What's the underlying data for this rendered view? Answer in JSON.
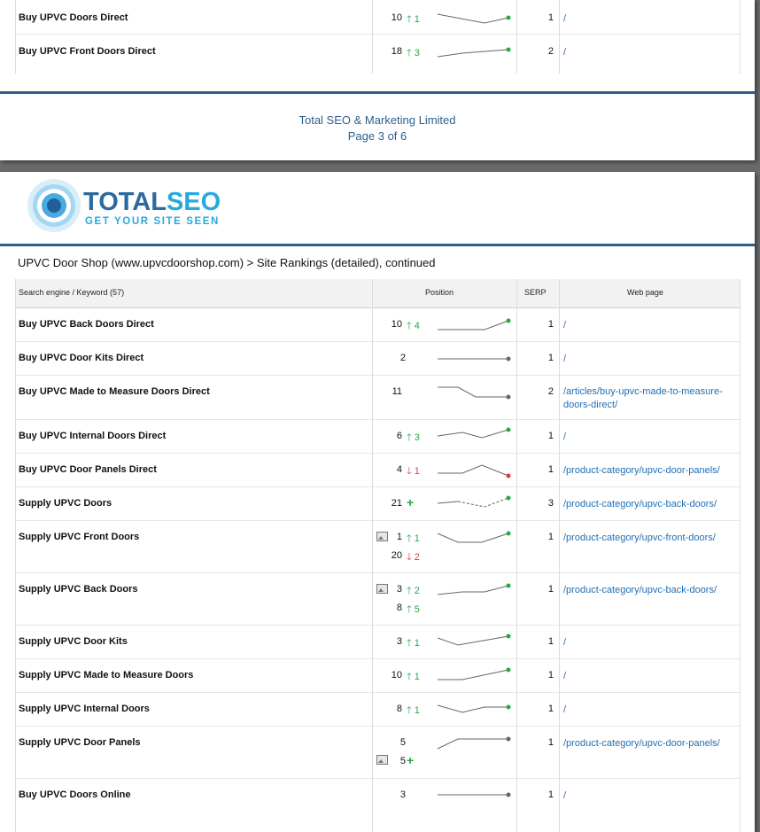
{
  "page1": {
    "rows": [
      {
        "keyword": "Buy UPVC Doors Direct",
        "position": "10",
        "change": "1",
        "trend": "up",
        "serp": "1",
        "url": "/"
      },
      {
        "keyword": "Buy UPVC Front Doors Direct",
        "position": "18",
        "change": "3",
        "trend": "up",
        "serp": "2",
        "url": "/"
      }
    ],
    "footer": {
      "company": "Total SEO & Marketing Limited",
      "page": "Page 3 of 6"
    }
  },
  "logo": {
    "name_part1": "TOTAL",
    "name_part2": "SEO",
    "tagline": "GET YOUR SITE SEEN",
    "color_dark": "#2a6aa0",
    "color_light": "#29a8e0"
  },
  "report": {
    "heading": "UPVC Door Shop (www.upvcdoorshop.com) > Site Rankings (detailed), continued"
  },
  "table": {
    "headers": {
      "keyword": "Search engine / Keyword (57)",
      "position": "Position",
      "serp": "SERP",
      "webpage": "Web page"
    },
    "rows": [
      {
        "keyword": "Buy UPVC Back Doors Direct",
        "positions": [
          {
            "value": "10",
            "change": "4",
            "trend": "up"
          }
        ],
        "serp": "1",
        "url": "/"
      },
      {
        "keyword": "Buy UPVC Door Kits Direct",
        "positions": [
          {
            "value": "2",
            "change": "",
            "trend": "none"
          }
        ],
        "serp": "1",
        "url": "/"
      },
      {
        "keyword": "Buy UPVC Made to Measure Doors Direct",
        "positions": [
          {
            "value": "11",
            "change": "",
            "trend": "none"
          }
        ],
        "serp": "2",
        "url": "/articles/buy-upvc-made-to-measure-doors-direct/"
      },
      {
        "keyword": "Buy UPVC Internal Doors Direct",
        "positions": [
          {
            "value": "6",
            "change": "3",
            "trend": "up"
          }
        ],
        "serp": "1",
        "url": "/"
      },
      {
        "keyword": "Buy UPVC Door Panels Direct",
        "positions": [
          {
            "value": "4",
            "change": "1",
            "trend": "down"
          }
        ],
        "serp": "1",
        "url": "/product-category/upvc-door-panels/"
      },
      {
        "keyword": "Supply UPVC Doors",
        "positions": [
          {
            "value": "21",
            "change": "",
            "trend": "new"
          }
        ],
        "serp": "3",
        "url": "/product-category/upvc-back-doors/"
      },
      {
        "keyword": "Supply UPVC Front Doors",
        "positions": [
          {
            "value": "1",
            "change": "1",
            "trend": "up",
            "image": true
          },
          {
            "value": "20",
            "change": "2",
            "trend": "down"
          }
        ],
        "serp": "1",
        "url": "/product-category/upvc-front-doors/"
      },
      {
        "keyword": "Supply UPVC Back Doors",
        "positions": [
          {
            "value": "3",
            "change": "2",
            "trend": "up",
            "image": true
          },
          {
            "value": "8",
            "change": "5",
            "trend": "up"
          }
        ],
        "serp": "1",
        "url": "/product-category/upvc-back-doors/"
      },
      {
        "keyword": "Supply UPVC Door Kits",
        "positions": [
          {
            "value": "3",
            "change": "1",
            "trend": "up"
          }
        ],
        "serp": "1",
        "url": "/"
      },
      {
        "keyword": "Supply UPVC Made to Measure Doors",
        "positions": [
          {
            "value": "10",
            "change": "1",
            "trend": "up"
          }
        ],
        "serp": "1",
        "url": "/"
      },
      {
        "keyword": "Supply UPVC Internal Doors",
        "positions": [
          {
            "value": "8",
            "change": "1",
            "trend": "up"
          }
        ],
        "serp": "1",
        "url": "/"
      },
      {
        "keyword": "Supply UPVC Door Panels",
        "positions": [
          {
            "value": "5",
            "change": "",
            "trend": "none"
          },
          {
            "value": "5",
            "change": "",
            "trend": "new",
            "image": true
          }
        ],
        "serp": "1",
        "url": "/product-category/upvc-door-panels/"
      },
      {
        "keyword": "Buy UPVC Doors Online",
        "positions": [
          {
            "value": "3",
            "change": "",
            "trend": "none"
          }
        ],
        "serp": "1",
        "url": "/"
      }
    ]
  },
  "colors": {
    "accent": "#2c5f8c",
    "link": "#1f6fb5",
    "up": "#27a844",
    "down": "#e03a3a"
  }
}
